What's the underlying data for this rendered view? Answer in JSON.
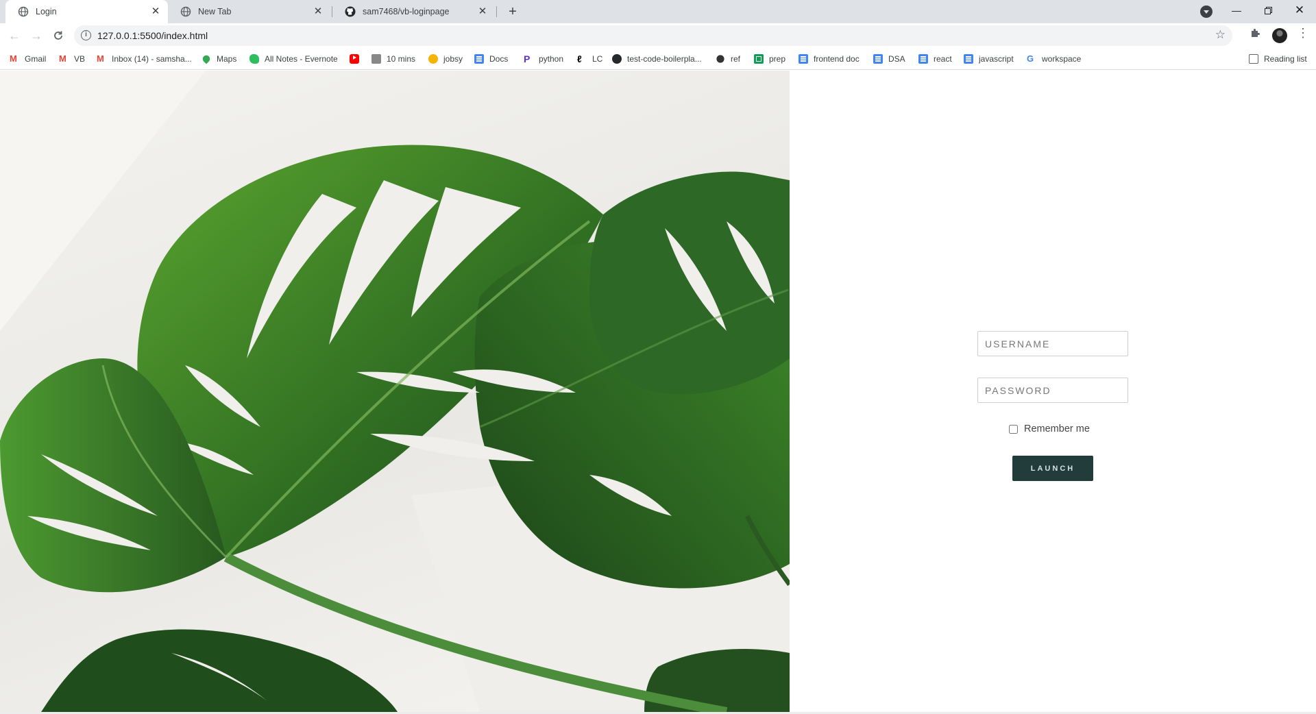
{
  "browser": {
    "tabs": [
      {
        "title": "Login",
        "active": true
      },
      {
        "title": "New Tab",
        "active": false
      },
      {
        "title": "sam7468/vb-loginpage",
        "active": false
      }
    ],
    "url": "127.0.0.1:5500/index.html",
    "bookmarks": [
      {
        "label": "Gmail",
        "icon": "gmail-icon"
      },
      {
        "label": "VB",
        "icon": "gmail-icon"
      },
      {
        "label": "Inbox (14) - samsha...",
        "icon": "gmail-icon"
      },
      {
        "label": "Maps",
        "icon": "maps-pin-icon"
      },
      {
        "label": "All Notes - Evernote",
        "icon": "evernote-icon"
      },
      {
        "label": "",
        "icon": "youtube-icon"
      },
      {
        "label": "10 mins",
        "icon": "clock-icon"
      },
      {
        "label": "jobsy",
        "icon": "jobsy-icon"
      },
      {
        "label": "Docs",
        "icon": "docs-icon"
      },
      {
        "label": "python",
        "icon": "python-icon"
      },
      {
        "label": "LC",
        "icon": "leetcode-icon"
      },
      {
        "label": "test-code-boilerpla...",
        "icon": "github-icon"
      },
      {
        "label": "ref",
        "icon": "ref-icon"
      },
      {
        "label": "prep",
        "icon": "sheets-icon"
      },
      {
        "label": "frontend doc",
        "icon": "docs-icon"
      },
      {
        "label": "DSA",
        "icon": "docs-icon"
      },
      {
        "label": "react",
        "icon": "docs-icon"
      },
      {
        "label": "javascript",
        "icon": "docs-icon"
      },
      {
        "label": "workspace",
        "icon": "google-icon"
      }
    ],
    "reading_list": "Reading list"
  },
  "login": {
    "username_placeholder": "USERNAME",
    "password_placeholder": "PASSWORD",
    "remember_label": "Remember me",
    "launch_label": "LAUNCH"
  },
  "colors": {
    "launch_button": "#223b3b",
    "leaf_dark": "#1f4d1c",
    "leaf_light": "#4f9a2c"
  }
}
